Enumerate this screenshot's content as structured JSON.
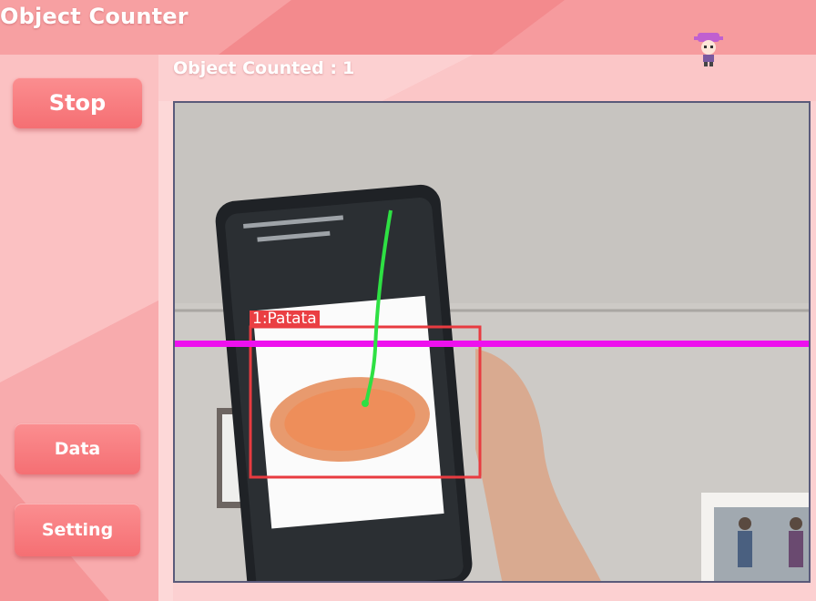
{
  "app": {
    "title": "Object Counter"
  },
  "header": {
    "mascot_icon": "mascot-icon"
  },
  "sidebar": {
    "stop_label": "Stop",
    "data_label": "Data",
    "setting_label": "Setting"
  },
  "counter": {
    "label": "Object Counted :",
    "value": "1"
  },
  "camera": {
    "detection_label": "1:Patata",
    "colors": {
      "counting_line": "#ee10ee",
      "track_line": "#2ee043",
      "bbox": "#e83b40"
    }
  },
  "theme": {
    "accent": "#f56f73",
    "background": "#f7a5a6"
  }
}
